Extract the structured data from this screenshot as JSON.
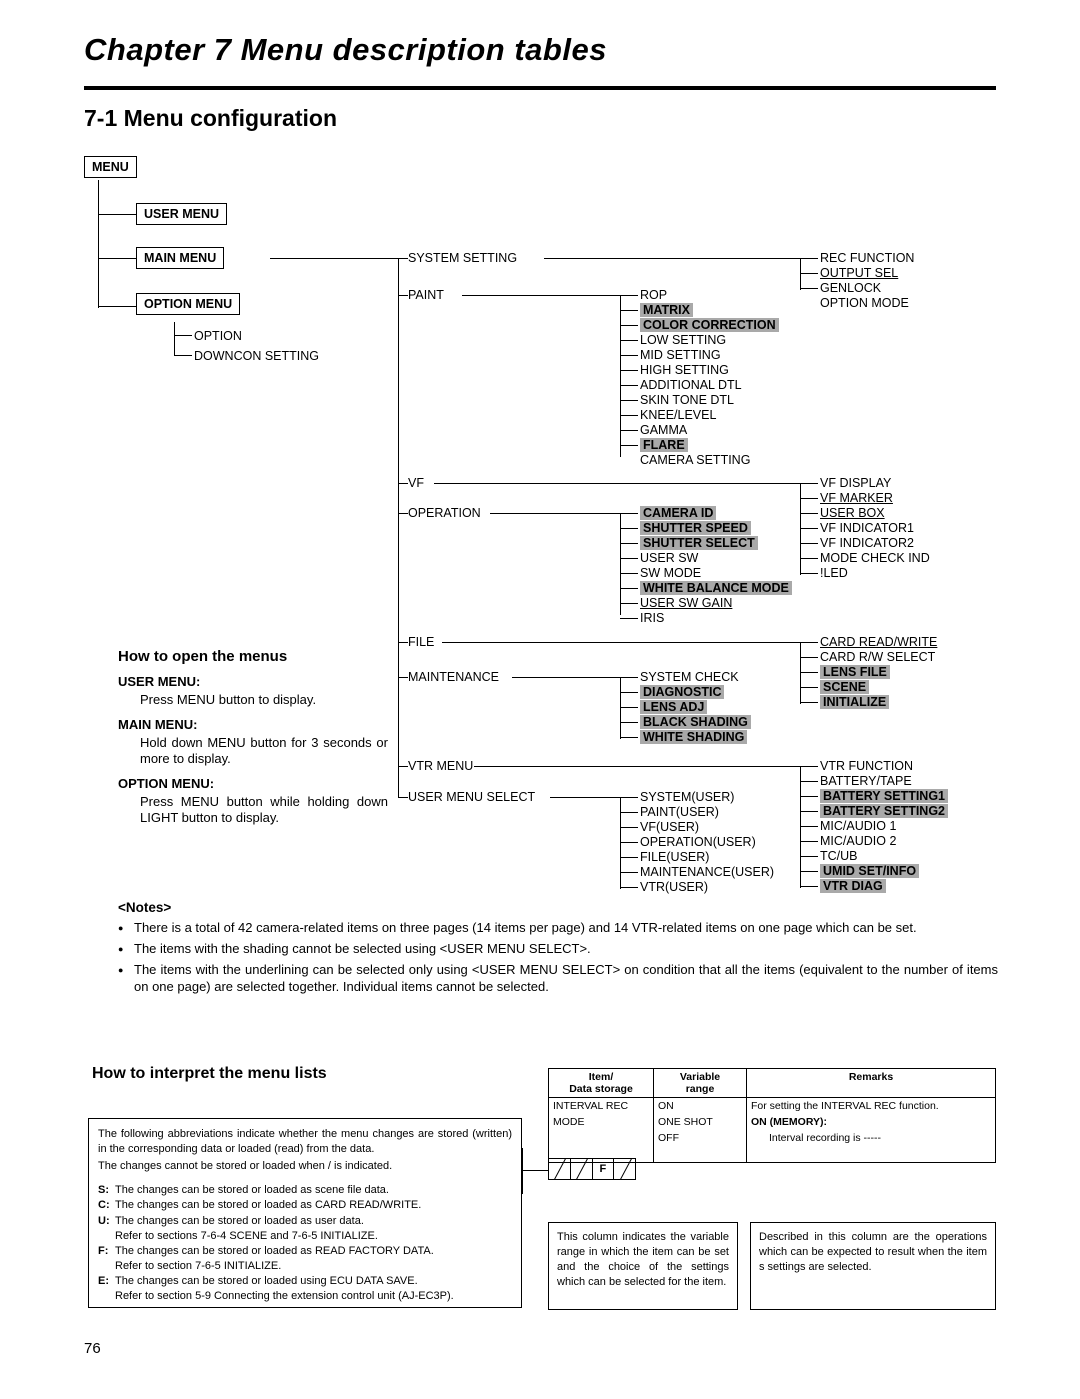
{
  "header": {
    "chapter": "Chapter 7  Menu description tables",
    "section": "7-1 Menu configuration"
  },
  "tree": {
    "menu": "MENU",
    "user_menu": "USER MENU",
    "main_menu": "MAIN MENU",
    "option_menu": "OPTION MENU",
    "option_children": [
      "OPTION",
      "DOWNCON SETTING"
    ],
    "col2": [
      "SYSTEM SETTING",
      "PAINT",
      "VF",
      "OPERATION",
      "FILE",
      "MAINTENANCE",
      "VTR MENU",
      "USER MENU SELECT"
    ],
    "paint_children": [
      "ROP",
      "MATRIX",
      "COLOR CORRECTION",
      "LOW SETTING",
      "MID SETTING",
      "HIGH SETTING",
      "ADDITIONAL DTL",
      "SKIN TONE DTL",
      "KNEE/LEVEL",
      "GAMMA",
      "FLARE",
      "CAMERA SETTING"
    ],
    "operation_children": [
      "CAMERA ID",
      "SHUTTER SPEED",
      "SHUTTER SELECT",
      "USER SW",
      "SW MODE",
      "WHITE BALANCE MODE",
      "USER SW GAIN",
      "IRIS"
    ],
    "maintenance_children": [
      "SYSTEM CHECK",
      "DIAGNOSTIC",
      "LENS ADJ",
      "BLACK SHADING",
      "WHITE SHADING"
    ],
    "usermenuselect_children": [
      "SYSTEM(USER)",
      "PAINT(USER)",
      "VF(USER)",
      "OPERATION(USER)",
      "FILE(USER)",
      "MAINTENANCE(USER)",
      "VTR(USER)"
    ],
    "col4_system": [
      "REC FUNCTION",
      "OUTPUT SEL"
    ],
    "col4_paint": [
      "GENLOCK",
      "OPTION MODE"
    ],
    "col4_vf": [
      "VF DISPLAY",
      "VF MARKER",
      "USER BOX",
      "VF INDICATOR1",
      "VF INDICATOR2",
      "MODE CHECK IND",
      "!LED"
    ],
    "col4_file": [
      "CARD READ/WRITE",
      "CARD R/W SELECT",
      "LENS FILE",
      "SCENE",
      "INITIALIZE"
    ],
    "col4_vtr": [
      "VTR FUNCTION",
      "BATTERY/TAPE",
      "BATTERY SETTING1",
      "BATTERY SETTING2",
      "MIC/AUDIO 1",
      "MIC/AUDIO 2",
      "TC/UB",
      "UMID SET/INFO",
      "VTR DIAG"
    ]
  },
  "howto": {
    "title": "How to open the menus",
    "user_menu_label": "USER MENU:",
    "user_menu_text": "Press MENU button to display.",
    "main_menu_label": "MAIN MENU:",
    "main_menu_text": "Hold down MENU button for 3 seconds or more to display.",
    "option_menu_label": "OPTION MENU:",
    "option_menu_text": "Press MENU button while holding down LIGHT button to display."
  },
  "notes": {
    "title": "<Notes>",
    "items": [
      "There is a total of 42 camera-related items on three pages (14 items per page) and 14 VTR-related items on one page which can be set.",
      "The items with the shading cannot be selected using <USER MENU SELECT>.",
      "The items with the underlining can be selected only using <USER MENU SELECT> on condition that all the items (equivalent to the number of items on one page) are selected together.  Individual items cannot be selected."
    ]
  },
  "interpret": {
    "title": "How to interpret the menu lists",
    "intro1": "The following abbreviations indicate whether the menu changes are stored (written) in the corresponding data or loaded (read) from the data.",
    "intro2": "The changes cannot be stored or loaded when  /  is indicated.",
    "abbrevs": [
      {
        "key": "S:",
        "text": "The changes can be stored or loaded as scene file data."
      },
      {
        "key": "C:",
        "text": "The changes can be stored or loaded as CARD READ/WRITE."
      },
      {
        "key": "U:",
        "text": "The changes can be stored or loaded as user data.",
        "sub": "Refer to sections  7-6-4 SCENE  and  7-6-5 INITIALIZE."
      },
      {
        "key": "F:",
        "text": "The changes can be stored or loaded as READ FACTORY DATA.",
        "sub": "Refer to section  7-6-5 INITIALIZE."
      },
      {
        "key": "E:",
        "text": "The changes can be stored or loaded using ECU DATA SAVE.",
        "sub": "Refer to section  5-9 Connecting the extension control unit (AJ-EC3P)."
      }
    ],
    "table": {
      "headers": [
        "Item/\nData storage",
        "Variable\nrange",
        "Remarks"
      ],
      "header_item_l1": "Item/",
      "header_item_l2": "Data storage",
      "header_var_l1": "Variable",
      "header_var_l2": "range",
      "header_remarks": "Remarks",
      "rows": [
        {
          "item": "INTERVAL REC",
          "range": "ON",
          "remarks": "For setting the INTERVAL REC function."
        },
        {
          "item": "MODE",
          "range": "ONE SHOT",
          "remarks": "ON (MEMORY):"
        },
        {
          "item": "",
          "range": "OFF",
          "remarks": "Interval recording is  -----"
        }
      ],
      "storage_icons": [
        "/",
        "/",
        "F",
        "/"
      ]
    },
    "desc_left": "This column indicates the variable range in which the item can be  set and the choice of the settings which can be selected for the item.",
    "desc_right": "Described in this column are the operations which can be expected to result when the item s settings are selected."
  },
  "page_number": "76"
}
